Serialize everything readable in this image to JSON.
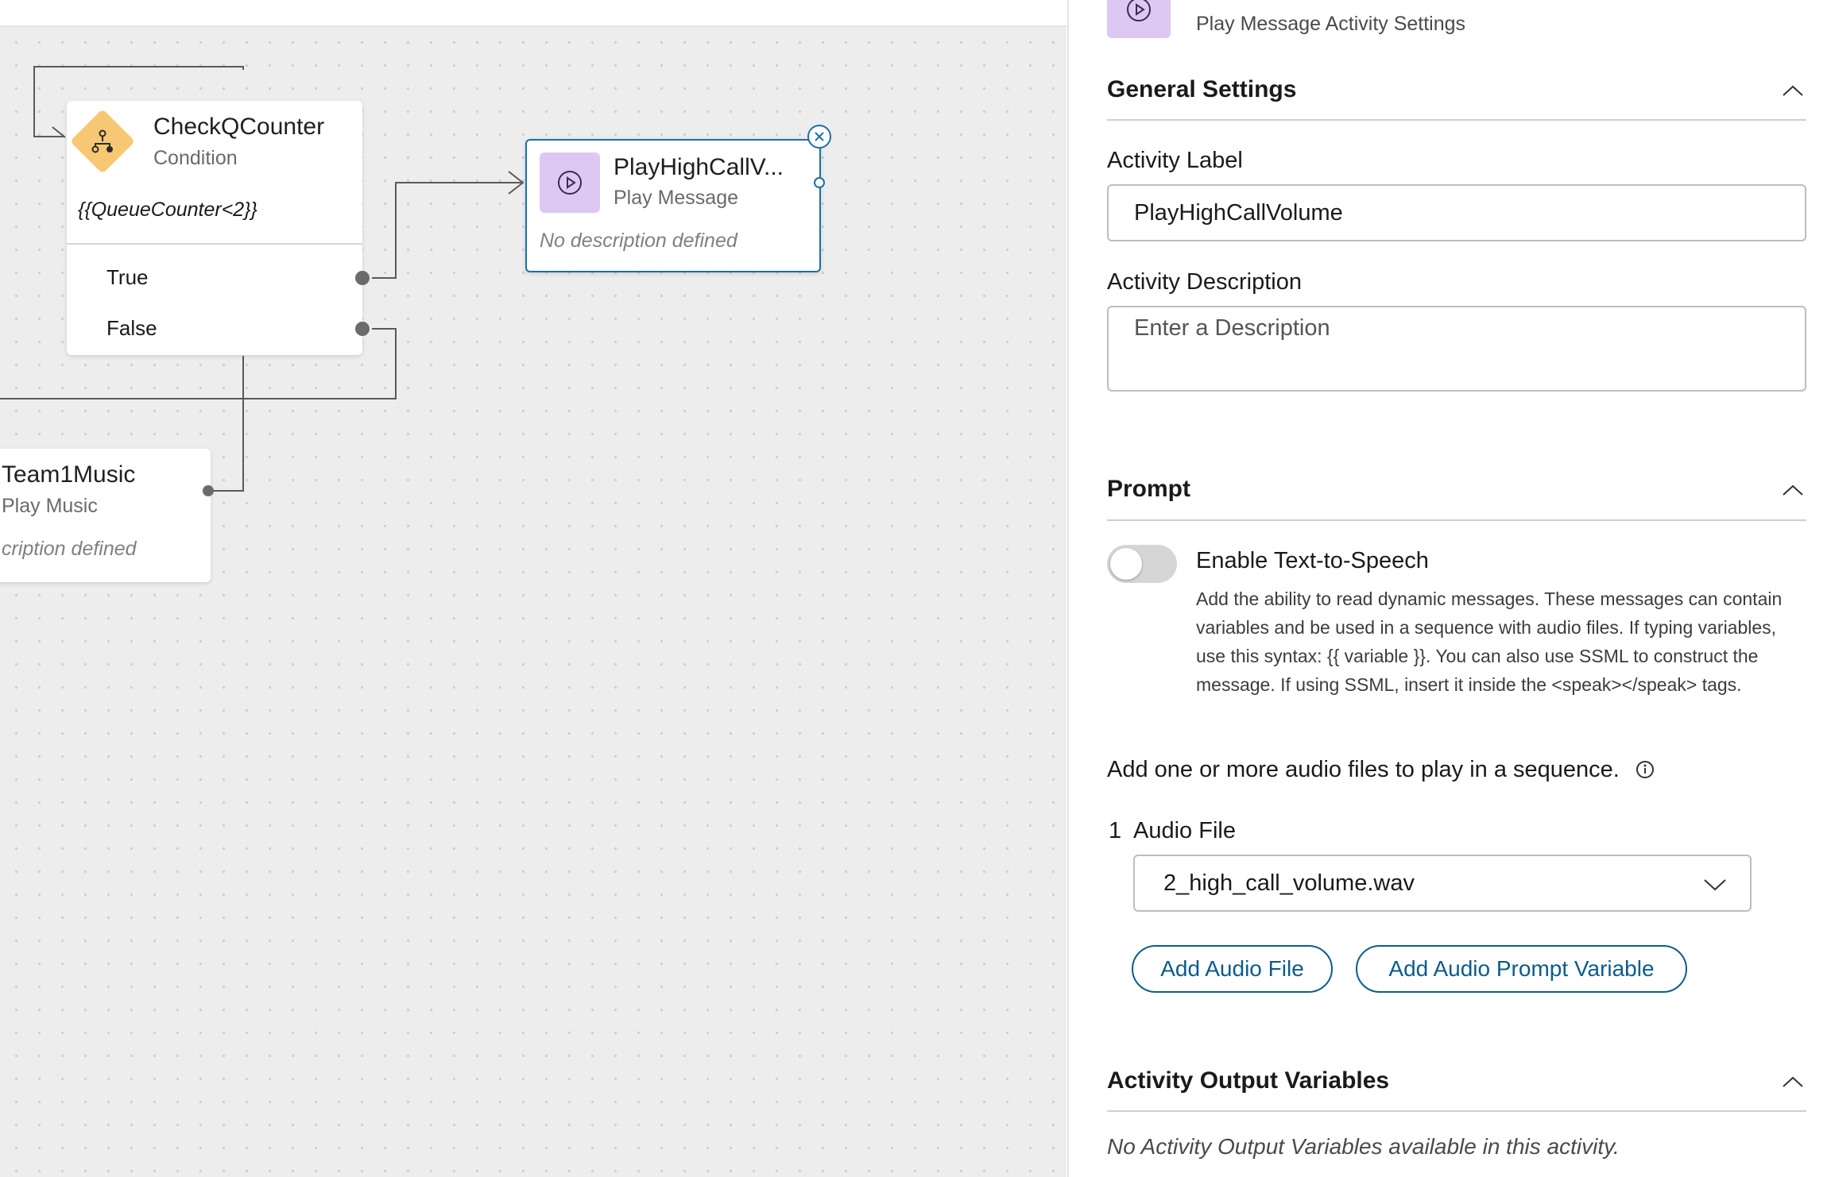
{
  "canvas": {
    "nodes": {
      "check_counter": {
        "title": "CheckQCounter",
        "type": "Condition",
        "expression": "{{QueueCounter<2}}",
        "branches": [
          "True",
          "False"
        ]
      },
      "play_high": {
        "title": "PlayHighCallV...",
        "type": "Play Message",
        "description": "No description defined"
      },
      "team_music": {
        "title": "Team1Music",
        "type": "Play Music",
        "description": "cription defined"
      }
    }
  },
  "panel": {
    "header_subtitle": "Play Message Activity Settings",
    "general": {
      "title": "General Settings",
      "label_label": "Activity Label",
      "label_value": "PlayHighCallVolume",
      "desc_label": "Activity Description",
      "desc_placeholder": "Enter a Description"
    },
    "prompt": {
      "title": "Prompt",
      "tts_label": "Enable Text-to-Speech",
      "tts_enabled": false,
      "tts_help": "Add the ability to read dynamic messages. These messages can contain variables and be used in a sequence with audio files. If typing variables, use this syntax: {{ variable }}. You can also use SSML to construct the message. If using SSML, insert it inside the <speak></speak> tags.",
      "audio_intro": "Add one or more audio files to play in a sequence.",
      "audio_index": "1",
      "audio_label": "Audio File",
      "audio_value": "2_high_call_volume.wav",
      "add_audio_button": "Add Audio File",
      "add_variable_button": "Add Audio Prompt Variable"
    },
    "output": {
      "title": "Activity Output Variables",
      "empty_text": "No Activity Output Variables available in this activity."
    }
  },
  "colors": {
    "accent": "#0d5c8a",
    "condition_icon": "#f7c873",
    "play_icon": "#dcc8f2",
    "canvas_bg": "#ededed"
  }
}
